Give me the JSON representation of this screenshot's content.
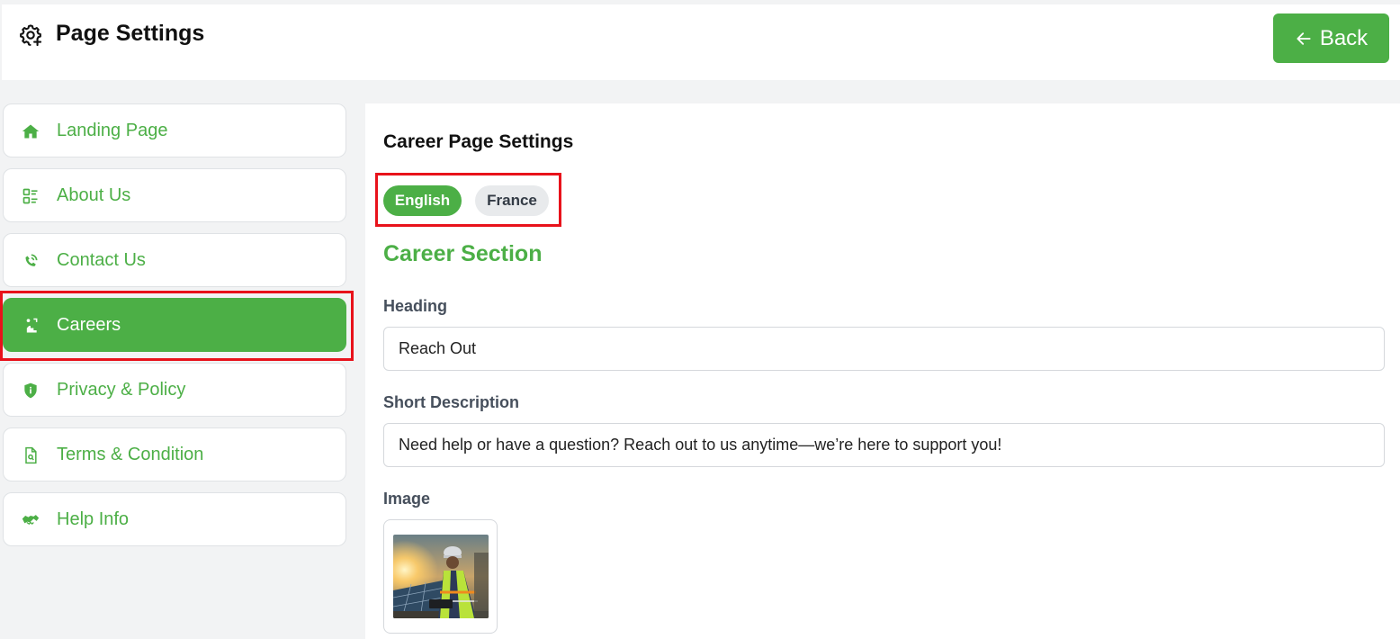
{
  "header": {
    "title": "Page Settings",
    "back_label": "Back",
    "icon": "gear-plus-icon"
  },
  "sidebar": {
    "items": [
      {
        "label": "Landing Page",
        "icon": "home-icon",
        "active": false
      },
      {
        "label": "About Us",
        "icon": "list-icon",
        "active": false
      },
      {
        "label": "Contact Us",
        "icon": "phone-signal-icon",
        "active": false
      },
      {
        "label": "Careers",
        "icon": "career-climb-icon",
        "active": true
      },
      {
        "label": "Privacy & Policy",
        "icon": "shield-info-icon",
        "active": false
      },
      {
        "label": "Terms & Condition",
        "icon": "document-search-icon",
        "active": false
      },
      {
        "label": "Help Info",
        "icon": "handshake-icon",
        "active": false
      }
    ]
  },
  "main": {
    "title": "Career Page Settings",
    "languages": [
      {
        "label": "English",
        "active": true
      },
      {
        "label": "France",
        "active": false
      }
    ],
    "section_title": "Career Section",
    "heading": {
      "label": "Heading",
      "value": "Reach Out"
    },
    "short_description": {
      "label": "Short Description",
      "value": "Need help or have a question? Reach out to us anytime—we’re here to support you!"
    },
    "image": {
      "label": "Image"
    }
  },
  "colors": {
    "accent": "#4caf46",
    "highlight": "#e8121b"
  }
}
